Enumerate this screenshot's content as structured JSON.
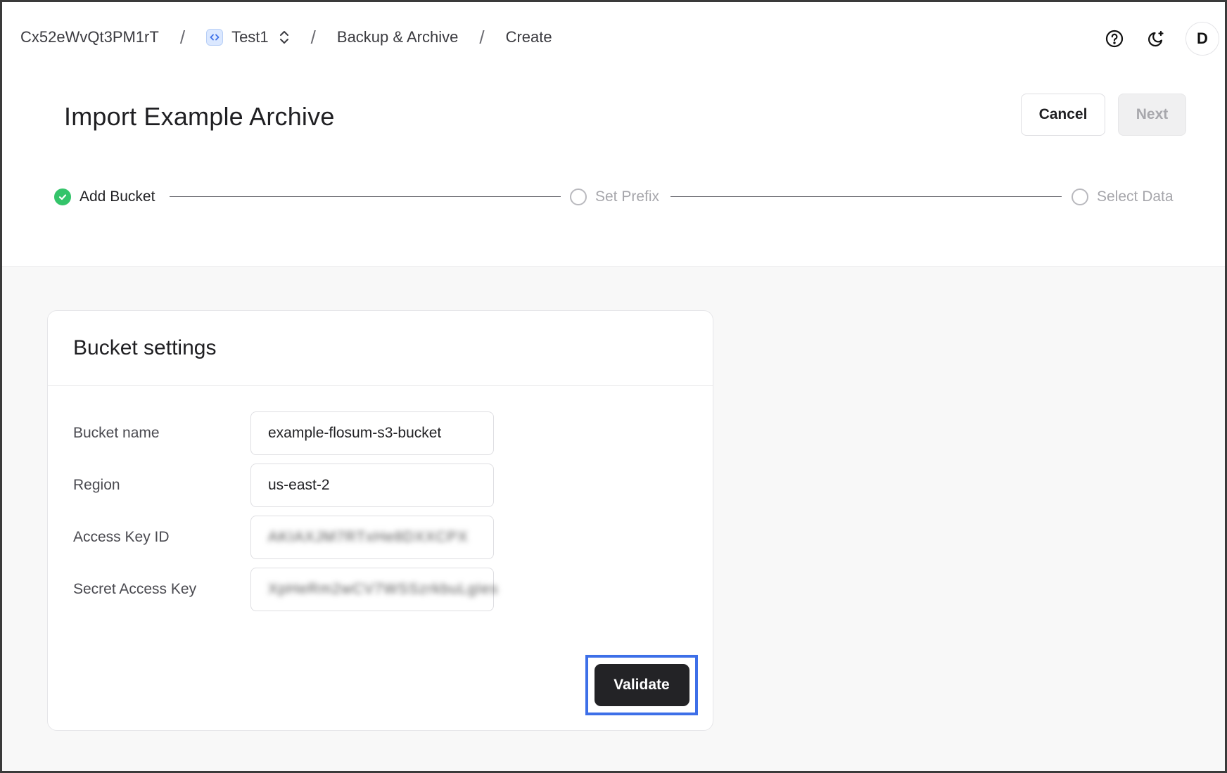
{
  "breadcrumb": {
    "org": "Cx52eWvQt3PM1rT",
    "environment": "Test1",
    "section": "Backup & Archive",
    "current": "Create",
    "separator": "/"
  },
  "header_actions": {
    "avatar_initial": "D",
    "icons": [
      "help-circle-icon",
      "moon-icon"
    ]
  },
  "page": {
    "title": "Import Example Archive",
    "cancel_label": "Cancel",
    "next_label": "Next"
  },
  "stepper": {
    "steps": [
      {
        "label": "Add Bucket",
        "status": "complete"
      },
      {
        "label": "Set Prefix",
        "status": "pending"
      },
      {
        "label": "Select Data",
        "status": "pending"
      }
    ]
  },
  "bucket_settings": {
    "title": "Bucket settings",
    "fields": [
      {
        "label": "Bucket name",
        "value": "example-flosum-s3-bucket",
        "masked": false
      },
      {
        "label": "Region",
        "value": "us-east-2",
        "masked": false
      },
      {
        "label": "Access Key ID",
        "value": "AKIAXJM7RTxHe8DXXCPX",
        "masked": true
      },
      {
        "label": "Secret Access Key",
        "value": "XpHeRm2wCV7WSSzrkbuLgIes",
        "masked": true
      }
    ],
    "validate_label": "Validate"
  },
  "colors": {
    "accent_highlight": "#3d6fe8",
    "step_complete": "#34c46a",
    "primary_button": "#232326"
  }
}
